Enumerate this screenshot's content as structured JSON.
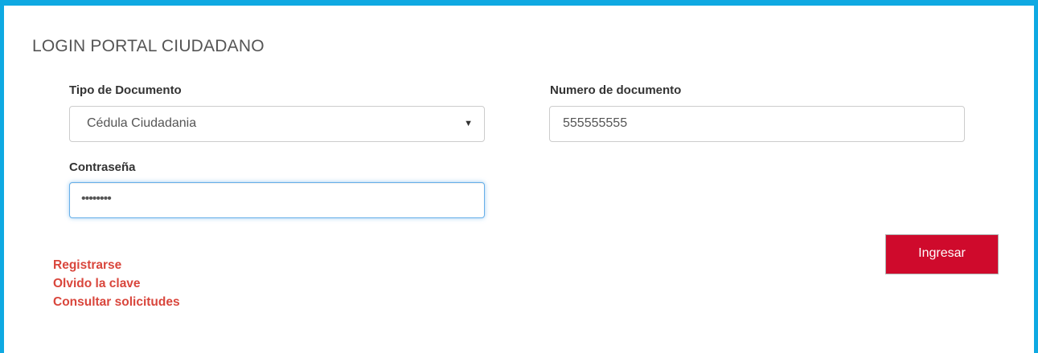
{
  "page": {
    "title": "LOGIN PORTAL CIUDADANO"
  },
  "form": {
    "tipo_documento": {
      "label": "Tipo de Documento",
      "selected": "Cédula Ciudadania"
    },
    "numero_documento": {
      "label": "Numero de documento",
      "value": "555555555"
    },
    "contrasena": {
      "label": "Contraseña",
      "value_masked": "••••••••"
    },
    "submit_label": "Ingresar"
  },
  "links": [
    {
      "label": "Registrarse"
    },
    {
      "label": "Olvido la clave"
    },
    {
      "label": "Consultar solicitudes"
    }
  ],
  "icons": {
    "select_arrow": "triangle-down-icon"
  },
  "colors": {
    "frame": "#0fa9e2",
    "button": "#cf0a2c",
    "links": "#d9463c",
    "focus": "#66afe9"
  }
}
